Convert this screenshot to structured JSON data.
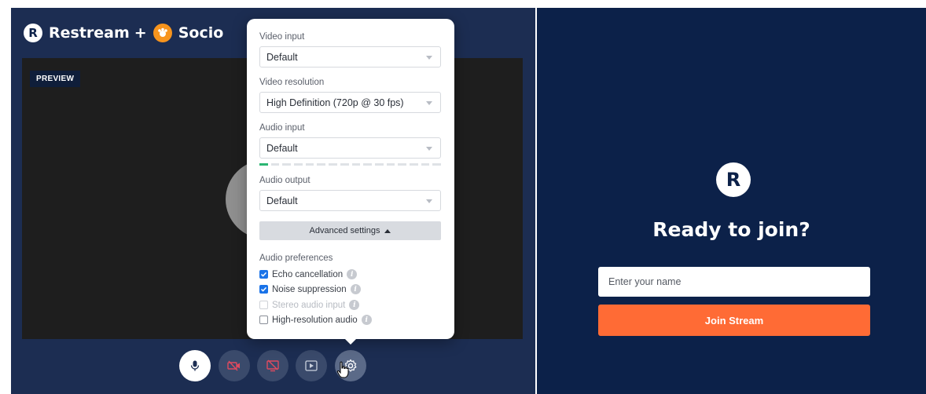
{
  "brand": {
    "restream_mark": "R",
    "restream_label": "Restream",
    "plus": "+",
    "socio_label": "Socio"
  },
  "preview": {
    "badge": "PREVIEW"
  },
  "device_settings": {
    "video_input": {
      "label": "Video input",
      "value": "Default"
    },
    "video_resolution": {
      "label": "Video resolution",
      "value": "High Definition (720p @ 30 fps)"
    },
    "audio_input": {
      "label": "Audio input",
      "value": "Default",
      "level_fraction": 0.06
    },
    "audio_output": {
      "label": "Audio output",
      "value": "Default"
    },
    "advanced_button": "Advanced settings",
    "audio_preferences": {
      "heading": "Audio preferences",
      "options": [
        {
          "label": "Echo cancellation",
          "checked": true,
          "disabled": false
        },
        {
          "label": "Noise suppression",
          "checked": true,
          "disabled": false
        },
        {
          "label": "Stereo audio input",
          "checked": false,
          "disabled": true
        },
        {
          "label": "High-resolution audio",
          "checked": false,
          "disabled": false
        }
      ]
    }
  },
  "controls": [
    "microphone",
    "camera-off",
    "screen-share-off",
    "media",
    "settings"
  ],
  "join": {
    "logo_mark": "R",
    "title": "Ready to join?",
    "name_placeholder": "Enter your name",
    "button": "Join Stream"
  },
  "colors": {
    "left_panel": "#1c2d52",
    "right_panel": "#0c2149",
    "accent_orange": "#ff6b35",
    "checkbox_blue": "#1a73e8",
    "meter_green": "#2bb673"
  }
}
